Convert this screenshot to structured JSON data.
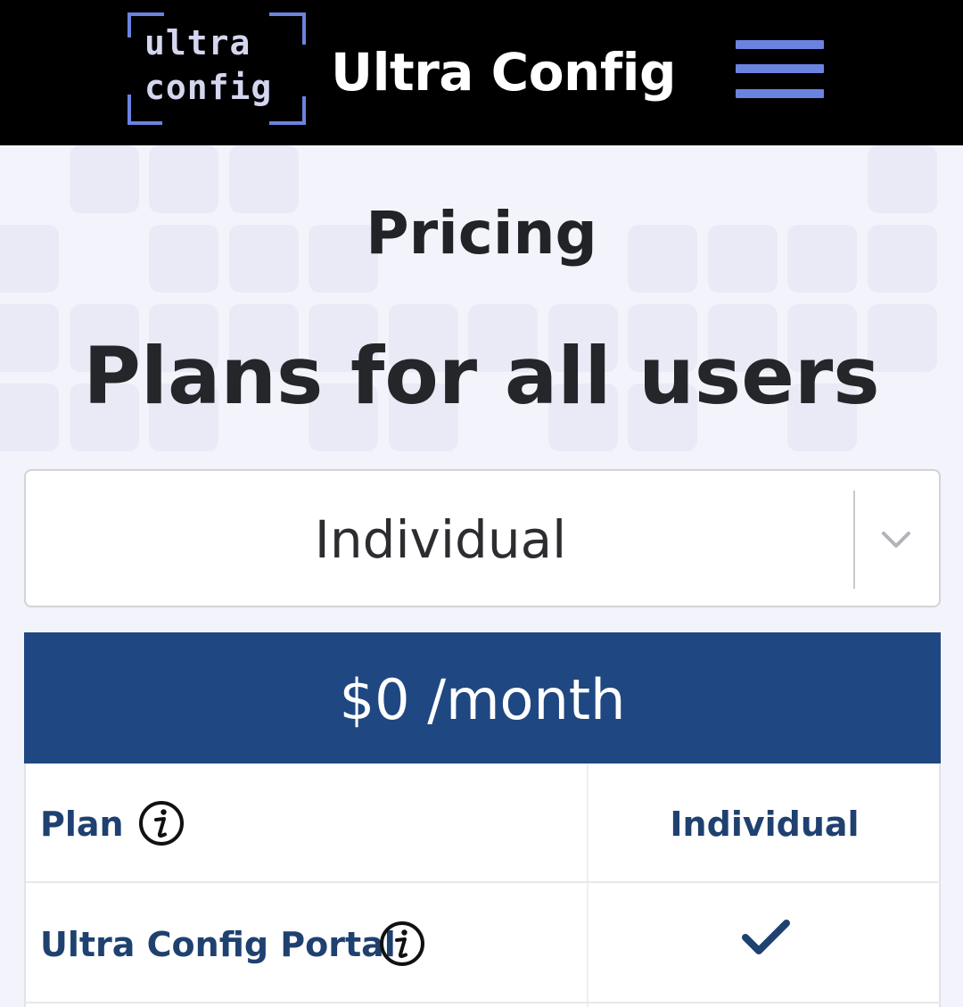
{
  "header": {
    "logo": {
      "line1": "ultra",
      "line2": "config"
    },
    "brand_name": "Ultra Config",
    "menu_icon": "hamburger-menu-icon",
    "logo_color": "#d3d6ee",
    "logo_frame_color": "#6b83e0"
  },
  "hero": {
    "eyebrow": "Pricing",
    "headline": "Plans for all users"
  },
  "plan_select": {
    "selected": "Individual",
    "icon": "chevron-down-icon"
  },
  "price": {
    "label": "$0 /month",
    "bar_color": "#1f4781"
  },
  "comparison_table": {
    "rows": [
      {
        "feature": "Plan",
        "value": "Individual",
        "info_icon": "info-icon"
      },
      {
        "feature": "Ultra Config Portal",
        "value_icon": "checkmark-icon",
        "info_icon": "info-icon"
      }
    ],
    "text_color": "#1f4170"
  }
}
